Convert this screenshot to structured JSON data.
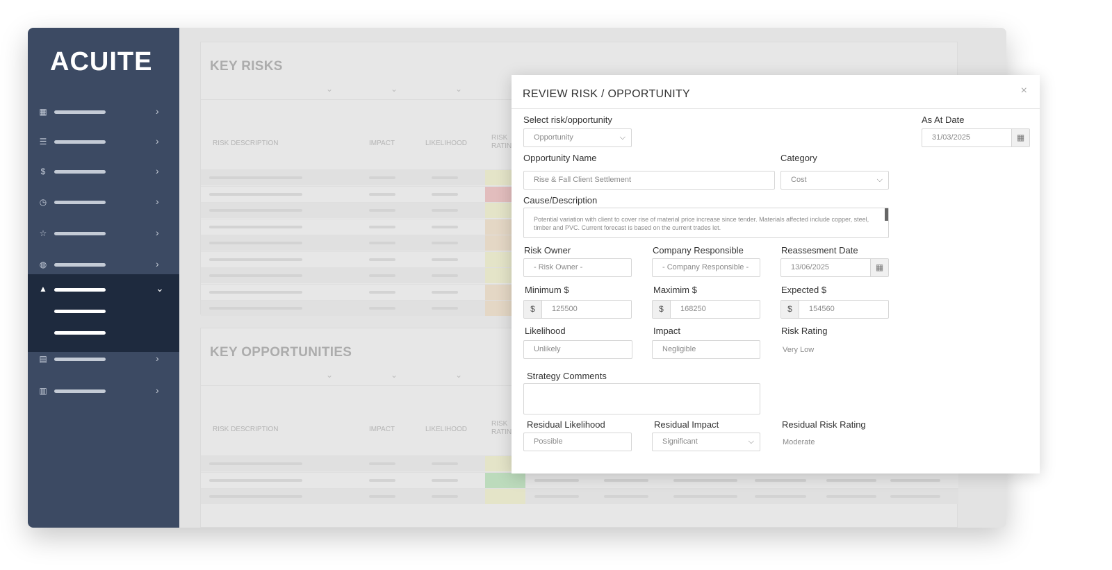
{
  "app": {
    "brand": "ACUITE"
  },
  "sidebar": {
    "icons": [
      "dashboard-icon",
      "list-icon",
      "dollar-icon",
      "clock-icon",
      "star-icon",
      "globe-icon",
      "warning-icon",
      "file-icon",
      "document-icon"
    ]
  },
  "key_risks": {
    "title": "KEY RISKS",
    "columns": [
      "RISK DESCRIPTION",
      "IMPACT",
      "LIKELIHOOD",
      "RISK RATING"
    ],
    "rating_colors": [
      "#e3e3b8",
      "#e0a8a8",
      "#e3e3b8",
      "#e4d0b4",
      "#e4d0b4",
      "#e3e3b8",
      "#e3e3b8",
      "#e4d0b4",
      "#e4d0b4"
    ]
  },
  "key_opportunities": {
    "title": "KEY OPPORTUNITIES",
    "columns": [
      "RISK DESCRIPTION",
      "IMPACT",
      "LIKELIHOOD",
      "RISK RATING"
    ],
    "rating_colors": [
      "#e3e3b8",
      "#a6d6a6",
      "#e3e3b8"
    ]
  },
  "modal": {
    "title": "REVIEW RISK / OPPORTUNITY",
    "close": "×",
    "select_label": "Select risk/opportunity",
    "select_value": "Opportunity",
    "as_at_label": "As At Date",
    "as_at_value": "31/03/2025",
    "opp_name_label": "Opportunity Name",
    "opp_name_value": "Rise & Fall Client Settlement",
    "category_label": "Category",
    "category_value": "Cost",
    "cause_label": "Cause/Description",
    "cause_value": "Potential variation with client to cover rise of material price increase since tender. Materials affected include copper, steel, timber and PVC. Current forecast is based on the current trades let.",
    "risk_owner_label": "Risk Owner",
    "risk_owner_value": "-    Risk Owner -",
    "company_label": "Company Responsible",
    "company_value": "-    Company Responsible -",
    "reassess_label": "Reassesment Date",
    "reassess_value": "13/06/2025",
    "min_label": "Minimum $",
    "min_value": "125500",
    "max_label": "Maximim $",
    "max_value": "168250",
    "exp_label": "Expected $",
    "exp_value": "154560",
    "currency": "$",
    "likelihood_label": "Likelihood",
    "likelihood_value": "Unlikely",
    "impact_label": "Impact",
    "impact_value": "Negligible",
    "risk_rating_label": "Risk Rating",
    "risk_rating_value": "Very Low",
    "strategy_label": "Strategy Comments",
    "strategy_value": "",
    "res_like_label": "Residual Likelihood",
    "res_like_value": "Possible",
    "res_impact_label": "Residual Impact",
    "res_impact_value": "Significant",
    "res_rating_label": "Residual Risk Rating",
    "res_rating_value": "Moderate"
  }
}
